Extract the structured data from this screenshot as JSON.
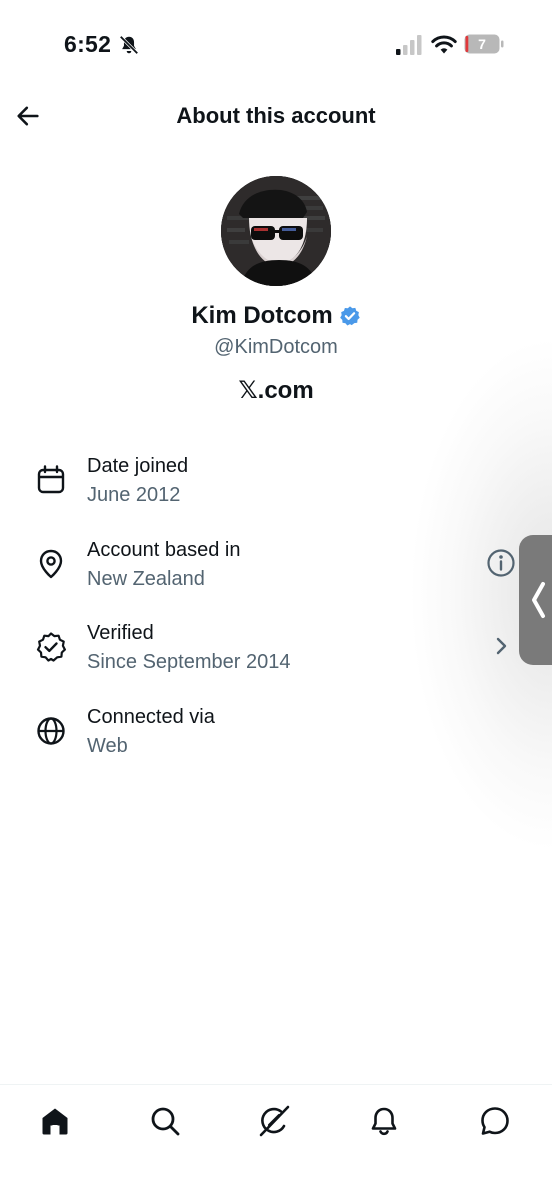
{
  "status_bar": {
    "time": "6:52",
    "battery_level": "7",
    "icons": [
      "bell-slash-icon",
      "cellular-signal-icon",
      "wifi-icon",
      "battery-icon"
    ]
  },
  "header": {
    "title": "About this account",
    "back_icon": "arrow-left-icon"
  },
  "profile": {
    "display_name": "Kim Dotcom",
    "handle": "@KimDotcom",
    "verified": true,
    "badge_color": "#4a99e9",
    "site": "𝕏.com"
  },
  "info_items": [
    {
      "icon": "calendar-icon",
      "label": "Date joined",
      "value": "June 2012"
    },
    {
      "icon": "location-pin-icon",
      "label": "Account based in",
      "value": "New Zealand",
      "action_icon": "info-circle-icon"
    },
    {
      "icon": "verified-seal-icon",
      "label": "Verified",
      "value": "Since September 2014",
      "action_icon": "chevron-right-icon"
    },
    {
      "icon": "globe-icon",
      "label": "Connected via",
      "value": "Web"
    }
  ],
  "tab_bar": {
    "tabs": [
      "home-icon",
      "search-icon",
      "grok-icon",
      "notifications-icon",
      "messages-icon"
    ],
    "active": "home-icon"
  },
  "colors": {
    "text_primary": "#0f1419",
    "text_secondary": "#536471",
    "verified_blue": "#4a99e9",
    "side_handle": "#7a7a7a"
  }
}
